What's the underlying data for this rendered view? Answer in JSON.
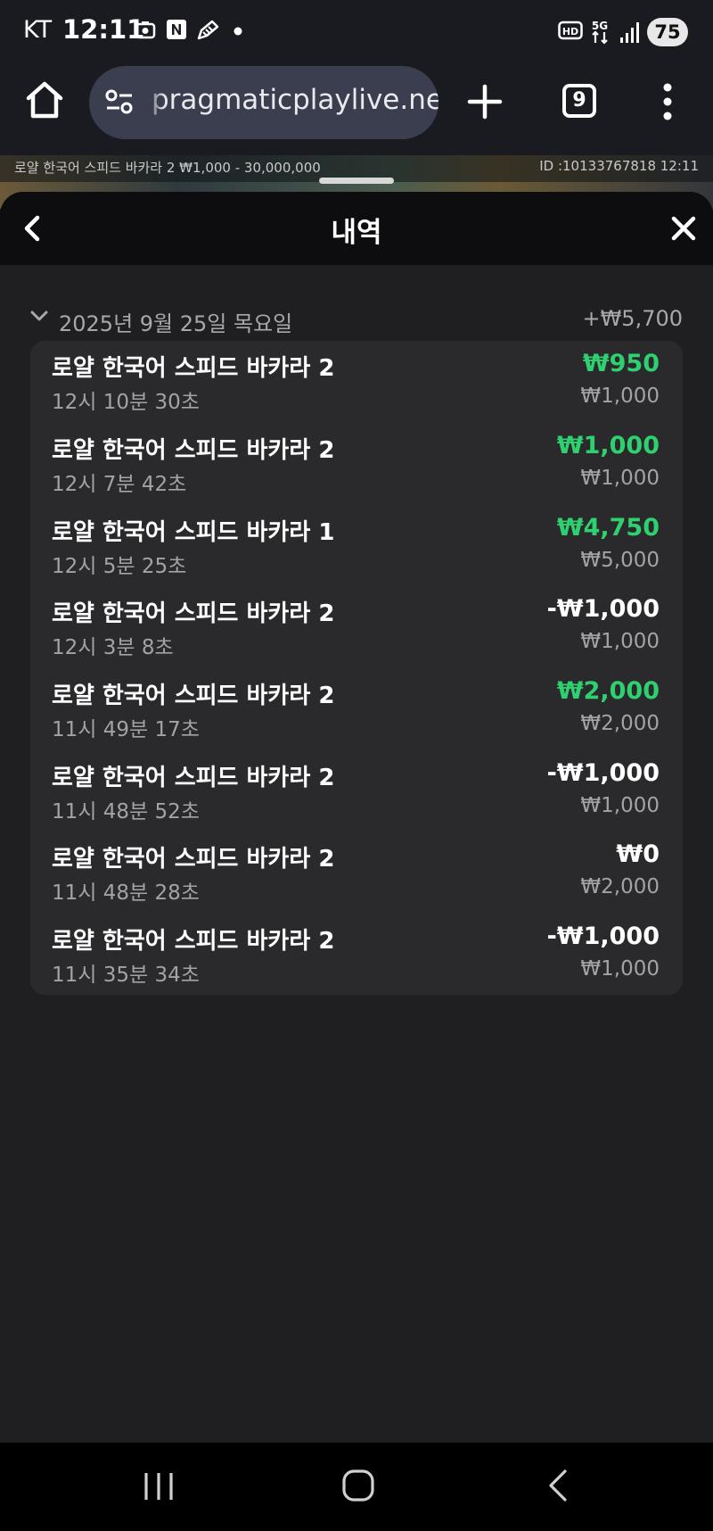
{
  "status_bar": {
    "carrier": "KT",
    "time": "12:11",
    "battery": "75",
    "icons": [
      "camera-icon",
      "n-notification-icon",
      "pencil-icon",
      "dot-icon",
      "hd-icon",
      "5g-icon",
      "signal-icon",
      "battery-icon"
    ]
  },
  "browser": {
    "url": "pragmaticplaylive.net",
    "tab_count": "9",
    "icons": [
      "home-icon",
      "site-settings-icon",
      "plus-icon",
      "tabs-icon",
      "more-vert-icon"
    ]
  },
  "game_strip": {
    "info": "로얄 한국어 스피드 바카라 2 ₩1,000 - 30,000,000",
    "id": "ID :10133767818 12:11"
  },
  "sheet": {
    "title": "내역"
  },
  "history": {
    "date": "2025년 9월 25일 목요일",
    "total": "+₩5,700",
    "items": [
      {
        "name": "로얄 한국어 스피드 바카라 2",
        "time": "12시 10분 30초",
        "result": "₩950",
        "bet": "₩1,000",
        "status": "win"
      },
      {
        "name": "로얄 한국어 스피드 바카라 2",
        "time": "12시 7분 42초",
        "result": "₩1,000",
        "bet": "₩1,000",
        "status": "win"
      },
      {
        "name": "로얄 한국어 스피드 바카라 1",
        "time": "12시 5분 25초",
        "result": "₩4,750",
        "bet": "₩5,000",
        "status": "win"
      },
      {
        "name": "로얄 한국어 스피드 바카라 2",
        "time": "12시 3분 8초",
        "result": "-₩1,000",
        "bet": "₩1,000",
        "status": "loss"
      },
      {
        "name": "로얄 한국어 스피드 바카라 2",
        "time": "11시 49분 17초",
        "result": "₩2,000",
        "bet": "₩2,000",
        "status": "win"
      },
      {
        "name": "로얄 한국어 스피드 바카라 2",
        "time": "11시 48분 52초",
        "result": "-₩1,000",
        "bet": "₩1,000",
        "status": "loss"
      },
      {
        "name": "로얄 한국어 스피드 바카라 2",
        "time": "11시 48분 28초",
        "result": "₩0",
        "bet": "₩2,000",
        "status": "neutral"
      },
      {
        "name": "로얄 한국어 스피드 바카라 2",
        "time": "11시 35분 34초",
        "result": "-₩1,000",
        "bet": "₩1,000",
        "status": "loss"
      }
    ]
  },
  "colors": {
    "win": "#2fd06f",
    "loss": "#ffffff",
    "neutral": "#ffffff",
    "background": "#1f1f21",
    "card": "#2a2a2c",
    "header": "#0d0d0f"
  }
}
